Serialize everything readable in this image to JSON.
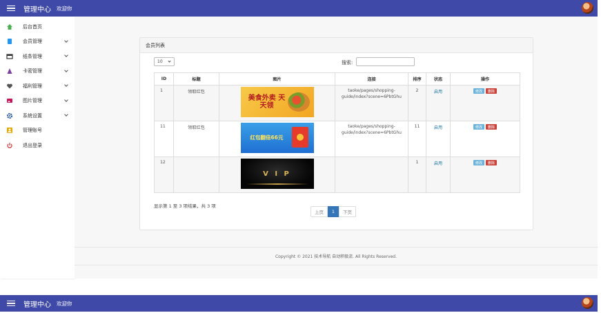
{
  "header": {
    "title": "管理中心",
    "welcome": "欢迎你"
  },
  "sidebar": {
    "items": [
      {
        "label": "后台首页",
        "icon": "home-icon",
        "color": "#4caf50",
        "expandable": false
      },
      {
        "label": "会员管理",
        "icon": "book-icon",
        "color": "#2196f3",
        "expandable": true
      },
      {
        "label": "纸条管理",
        "icon": "card-icon",
        "color": "#333333",
        "expandable": true
      },
      {
        "label": "卡密管理",
        "icon": "triangle-icon",
        "color": "#7b3fa0",
        "expandable": true
      },
      {
        "label": "福利管理",
        "icon": "heart-icon",
        "color": "#555555",
        "expandable": true
      },
      {
        "label": "图片管理",
        "icon": "image-icon",
        "color": "#c2185b",
        "expandable": true
      },
      {
        "label": "系统设置",
        "icon": "gear-icon",
        "color": "#1a4fa0",
        "expandable": true
      },
      {
        "label": "管理账号",
        "icon": "user-icon",
        "color": "#e6a700",
        "expandable": false
      },
      {
        "label": "退出登录",
        "icon": "power-icon",
        "color": "#d32f2f",
        "expandable": false
      }
    ]
  },
  "card": {
    "title": "会员列表",
    "page_length": "10",
    "search_label": "搜索:"
  },
  "table": {
    "headers": [
      "ID",
      "标题",
      "图片",
      "连接",
      "排序",
      "状态",
      "操作"
    ],
    "rows": [
      {
        "id": "1",
        "title": "领取红包",
        "image_text": "美食外卖 天天领",
        "link": "taoke/pages/shopping-guide/index?scene=6PbtGhu",
        "order": "2",
        "status": "启用"
      },
      {
        "id": "11",
        "title": "领取红包",
        "image_text": "红包翻倍66元",
        "link": "taoke/pages/shopping-guide/index?scene=6PbtGhu",
        "order": "11",
        "status": "启用"
      },
      {
        "id": "12",
        "title": "",
        "image_text": "V I P",
        "link": "",
        "order": "1",
        "status": "启用"
      }
    ],
    "edit_label": "修改",
    "delete_label": "删除"
  },
  "info_text": "显示第 1 至 3 项结果，共 3 项",
  "pager": {
    "prev": "上页",
    "current": "1",
    "next": "下页"
  },
  "footer": "Copyright © 2021 技术导航 自动积极流. All Rights Reserved."
}
